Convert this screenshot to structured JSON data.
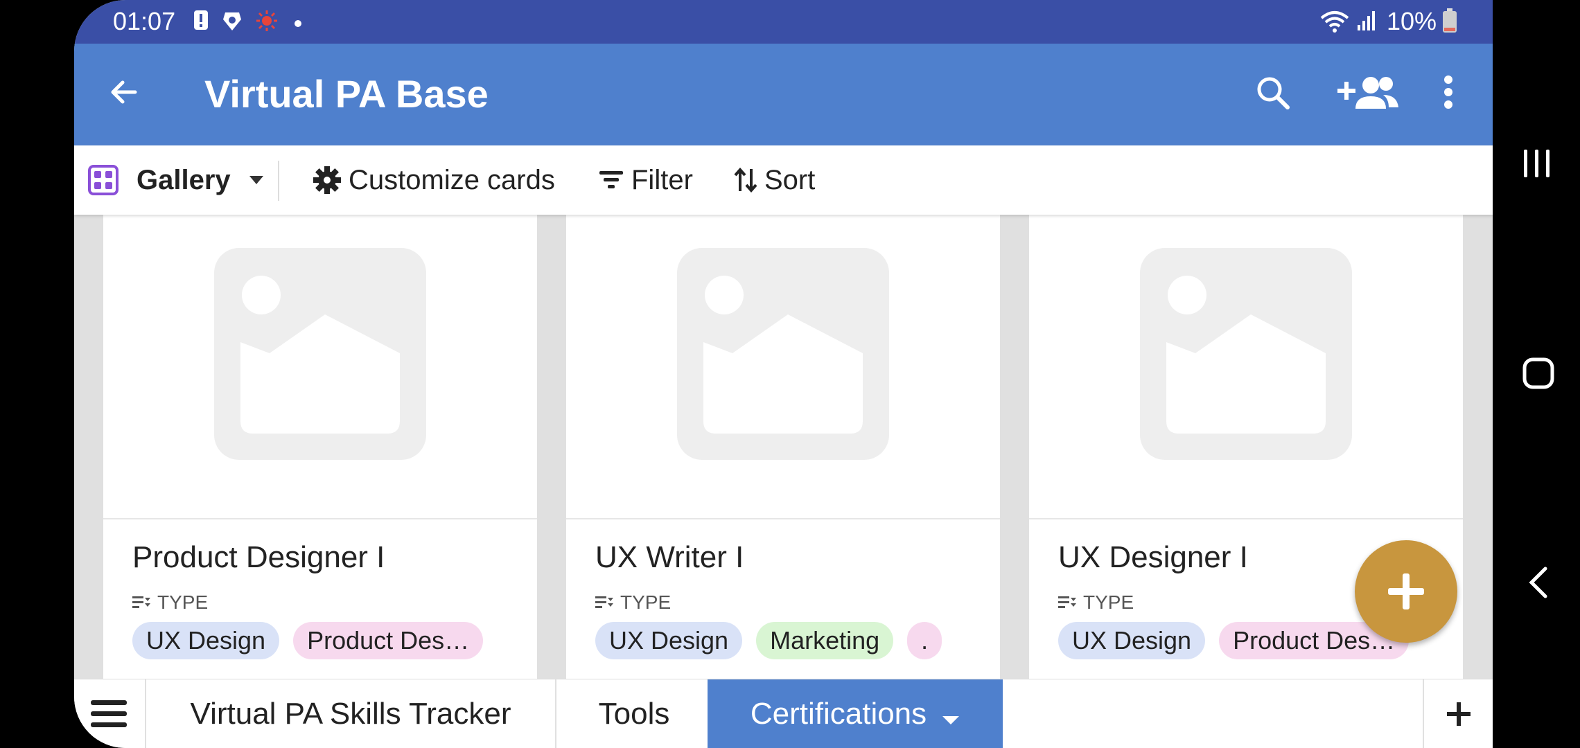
{
  "status": {
    "time": "01:07",
    "battery": "10%"
  },
  "appbar": {
    "title": "Virtual PA Base"
  },
  "toolbar": {
    "view": "Gallery",
    "customize": "Customize cards",
    "filter": "Filter",
    "sort": "Sort"
  },
  "cards": [
    {
      "title": "Product Designer I",
      "type_label": "TYPE",
      "tags": [
        "UX Design",
        "Product Des…"
      ]
    },
    {
      "title": "UX Writer I",
      "type_label": "TYPE",
      "tags": [
        "UX Design",
        "Marketing",
        "."
      ]
    },
    {
      "title": "UX Designer I",
      "type_label": "TYPE",
      "tags": [
        "UX Design",
        "Product Des…"
      ]
    }
  ],
  "bottom_tabs": [
    {
      "label": "Virtual PA Skills Tracker"
    },
    {
      "label": "Tools"
    },
    {
      "label": "Certifications"
    }
  ],
  "colors": {
    "status_bar": "#3a4fa6",
    "app_bar": "#4f80cd",
    "fab": "#c8963e",
    "gallery_icon": "#8a4fd8"
  },
  "icons": [
    "back-arrow-icon",
    "search-icon",
    "add-person-icon",
    "more-vert-icon",
    "gallery-grid-icon",
    "gear-icon",
    "filter-icon",
    "sort-icon",
    "image-placeholder-icon",
    "plus-icon",
    "hamburger-icon"
  ]
}
